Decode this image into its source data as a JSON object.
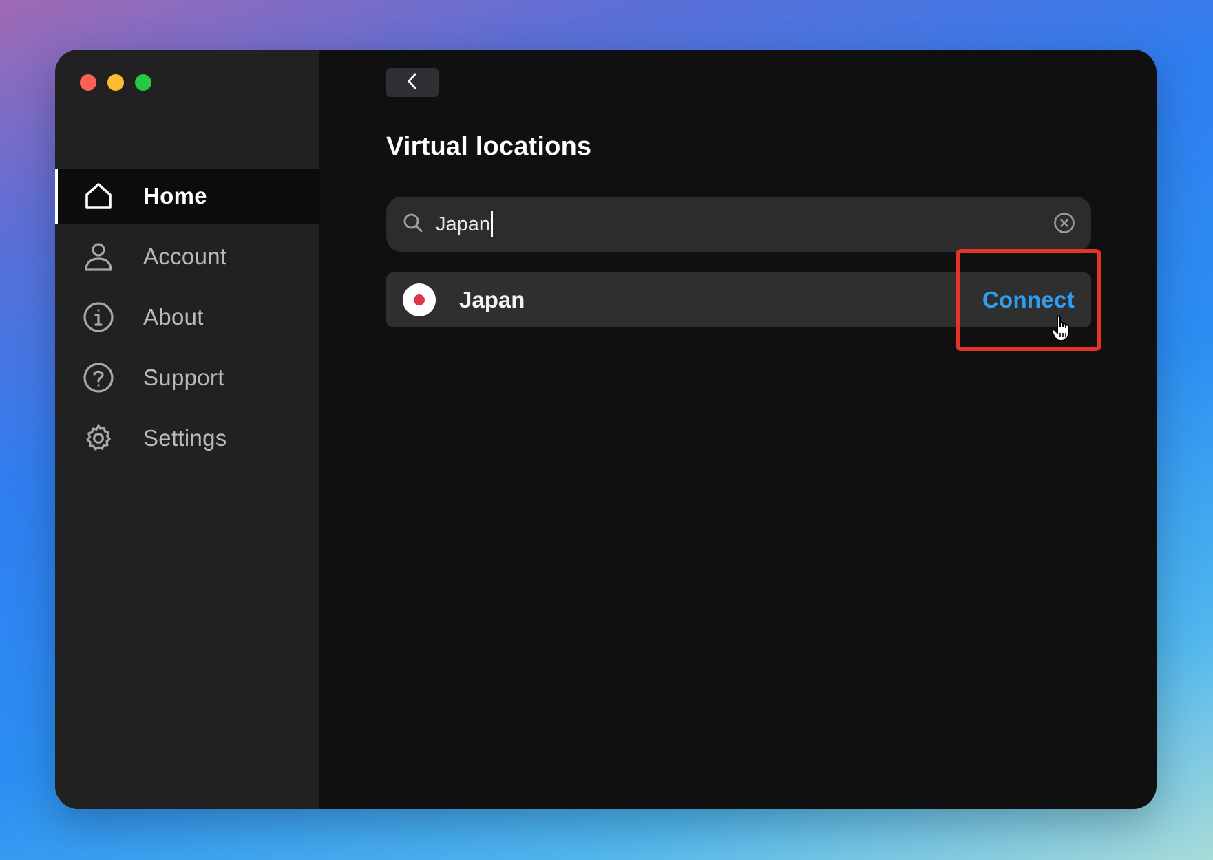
{
  "window": {
    "traffic_lights": {
      "close_color": "#fe5f57",
      "minimize_color": "#febc2e",
      "maximize_color": "#28c840"
    }
  },
  "sidebar": {
    "items": [
      {
        "label": "Home",
        "icon": "home-icon",
        "active": true
      },
      {
        "label": "Account",
        "icon": "user-icon",
        "active": false
      },
      {
        "label": "About",
        "icon": "info-icon",
        "active": false
      },
      {
        "label": "Support",
        "icon": "help-icon",
        "active": false
      },
      {
        "label": "Settings",
        "icon": "gear-icon",
        "active": false
      }
    ]
  },
  "main": {
    "back_icon": "chevron-left-icon",
    "title": "Virtual locations",
    "search": {
      "value": "Japan",
      "icon": "search-icon",
      "clear_icon": "clear-icon"
    },
    "results": [
      {
        "country": "Japan",
        "flag_icon": "japan-flag-icon",
        "action_label": "Connect",
        "action_color": "#2e9ef2"
      }
    ]
  },
  "annotation": {
    "highlight_color": "#e3342a",
    "cursor": "pointer-hand-icon"
  }
}
